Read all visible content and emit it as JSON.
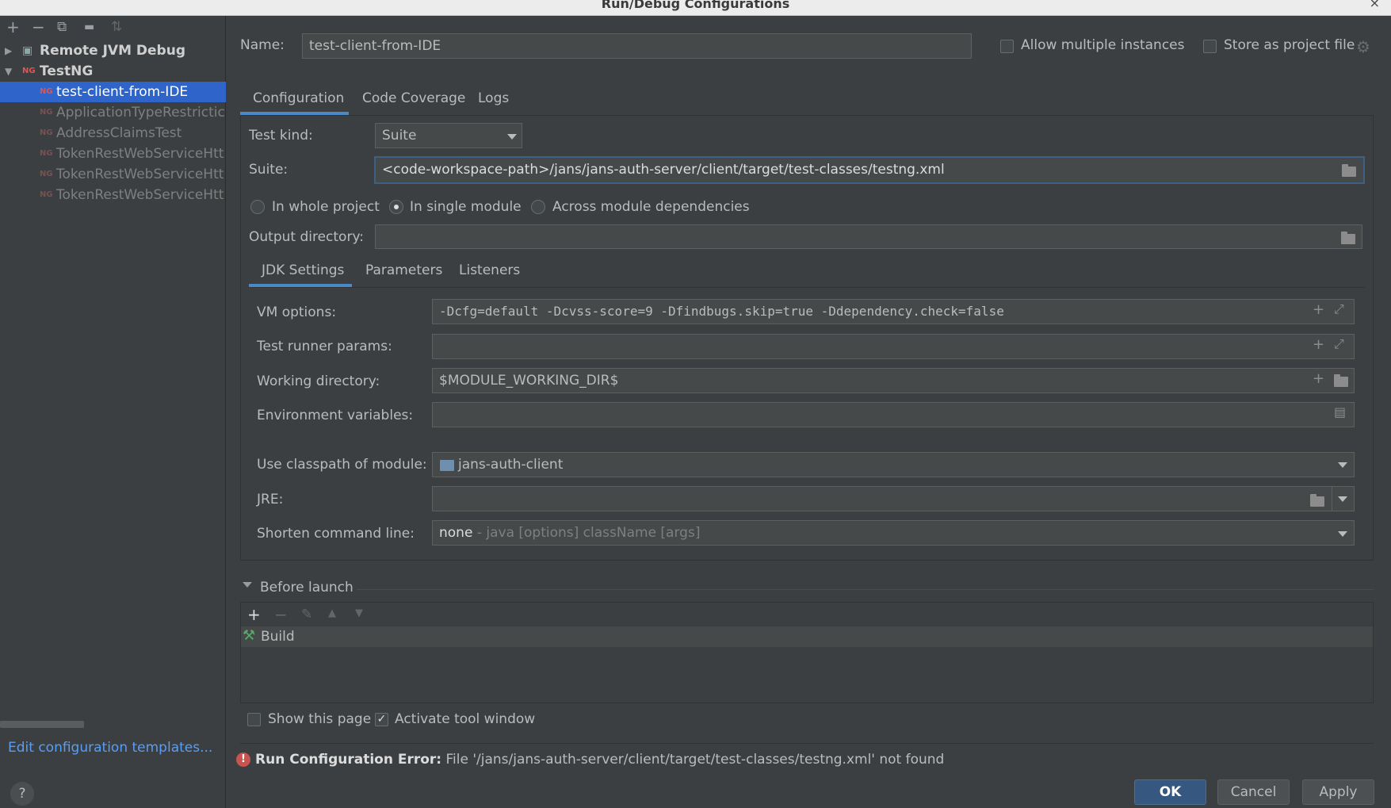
{
  "window": {
    "title": "Run/Debug Configurations",
    "close_glyph": "×"
  },
  "left": {
    "toolbar": [
      {
        "name": "add-icon",
        "glyph": "+"
      },
      {
        "name": "remove-icon",
        "glyph": "−"
      },
      {
        "name": "copy-icon",
        "glyph": "⧉"
      },
      {
        "name": "folder-icon",
        "glyph": "▬"
      },
      {
        "name": "sort-icon",
        "glyph": "⇅"
      }
    ],
    "tree": {
      "remote_jvm": "Remote JVM Debug",
      "testng": "TestNG",
      "items": [
        "test-client-from-IDE",
        "ApplicationTypeRestrictic",
        "AddressClaimsTest",
        "TokenRestWebServiceHtt",
        "TokenRestWebServiceHtt",
        "TokenRestWebServiceHtt"
      ]
    },
    "edit_templates": "Edit configuration templates...",
    "help": "?"
  },
  "header": {
    "name_label": "Name:",
    "name_value": "test-client-from-IDE",
    "allow_multiple": "Allow multiple instances",
    "store_project": "Store as project file"
  },
  "tabs": [
    "Configuration",
    "Code Coverage",
    "Logs"
  ],
  "config": {
    "test_kind_label": "Test kind:",
    "test_kind_value": "Suite",
    "suite_label": "Suite:",
    "suite_value": "<code-workspace-path>/jans/jans-auth-server/client/target/test-classes/testng.xml",
    "scope": [
      "In whole project",
      "In single module",
      "Across module dependencies"
    ],
    "output_dir_label": "Output directory:",
    "output_dir_value": ""
  },
  "subtabs": [
    "JDK Settings",
    "Parameters",
    "Listeners"
  ],
  "jdk": {
    "vm_label": "VM options:",
    "vm_value": "-Dcfg=default -Dcvss-score=9 -Dfindbugs.skip=true -Ddependency.check=false",
    "runner_label": "Test runner params:",
    "runner_value": "",
    "workdir_label": "Working directory:",
    "workdir_value": "$MODULE_WORKING_DIR$",
    "env_label": "Environment variables:",
    "env_value": "",
    "classpath_label": "Use classpath of module:",
    "classpath_value": "jans-auth-client",
    "jre_label": "JRE:",
    "jre_value": "",
    "shorten_label": "Shorten command line:",
    "shorten_value": "none",
    "shorten_hint": " - java [options] className [args]"
  },
  "before_launch": {
    "title": "Before launch",
    "tools": [
      "+",
      "−",
      "✎",
      "▲",
      "▼"
    ],
    "items": [
      "Build"
    ]
  },
  "footer": {
    "show_page": "Show this page",
    "activate_tool": "Activate tool window",
    "error_label": "Run Configuration Error:",
    "error_text": " File '/jans/jans-auth-server/client/target/test-classes/testng.xml' not found",
    "ok": "OK",
    "cancel": "Cancel",
    "apply": "Apply"
  },
  "colors": {
    "accent": "#4a88c7",
    "selection": "#2f65ca",
    "error": "#c75450",
    "link": "#589df6"
  }
}
